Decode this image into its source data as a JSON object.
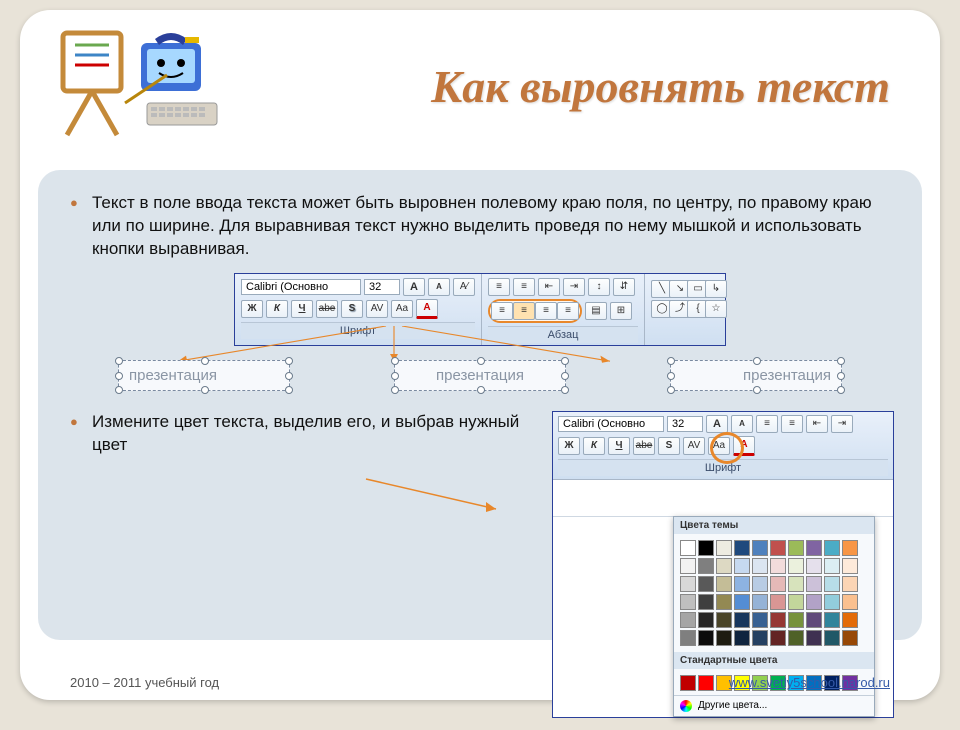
{
  "title": "Как выровнять текст",
  "bullets": {
    "b1": "Текст в поле ввода текста может быть выровнен полевому краю поля, по центру, по правому краю или по ширине. Для выравнивая текст нужно выделить проведя по нему мышкой и использовать кнопки выравнивая.",
    "b2": "Измените цвет текста, выделив его, и выбрав нужный цвет"
  },
  "ribbon": {
    "font_name": "Calibri (Основно",
    "font_size": "32",
    "group_font": "Шрифт",
    "group_para": "Абзац",
    "btn_bold": "Ж",
    "btn_italic": "К",
    "btn_under": "Ч",
    "btn_strike": "abe",
    "btn_shadow": "S",
    "btn_av": "AV",
    "btn_aa": "Aa",
    "btn_color": "A",
    "btn_grow": "A",
    "btn_shrink": "A",
    "btn_clear": "A⁄"
  },
  "samples": {
    "text": "презентация"
  },
  "color_panel": {
    "title_theme": "Цвета темы",
    "title_standard": "Стандартные цвета",
    "more": "Другие цвета..."
  },
  "footer": {
    "left": "2010 – 2011 учебный год",
    "right": "www.svetly5school.narod.ru"
  },
  "colors": {
    "theme": [
      "#ffffff",
      "#000000",
      "#eeece1",
      "#1f497d",
      "#4f81bd",
      "#c0504d",
      "#9bbb59",
      "#8064a2",
      "#4bacc6",
      "#f79646"
    ],
    "theme_tints": [
      [
        "#f2f2f2",
        "#7f7f7f",
        "#ddd9c3",
        "#c6d9f0",
        "#dbe5f1",
        "#f2dcdb",
        "#ebf1dd",
        "#e5e0ec",
        "#dbeef3",
        "#fdeada"
      ],
      [
        "#d8d8d8",
        "#595959",
        "#c4bd97",
        "#8db3e2",
        "#b8cce4",
        "#e5b9b7",
        "#d7e3bc",
        "#ccc1d9",
        "#b7dde8",
        "#fbd5b5"
      ],
      [
        "#bfbfbf",
        "#3f3f3f",
        "#938953",
        "#548dd4",
        "#95b3d7",
        "#d99694",
        "#c3d69b",
        "#b2a2c7",
        "#92cddc",
        "#fac08f"
      ],
      [
        "#a5a5a5",
        "#262626",
        "#494429",
        "#17365d",
        "#366092",
        "#953734",
        "#76923c",
        "#5f497a",
        "#31859b",
        "#e36c09"
      ],
      [
        "#7f7f7f",
        "#0c0c0c",
        "#1d1b10",
        "#0f243e",
        "#244061",
        "#632423",
        "#4f6128",
        "#3f3151",
        "#205867",
        "#974806"
      ]
    ],
    "standard": [
      "#c00000",
      "#ff0000",
      "#ffc000",
      "#ffff00",
      "#92d050",
      "#00b050",
      "#00b0f0",
      "#0070c0",
      "#002060",
      "#7030a0"
    ]
  }
}
